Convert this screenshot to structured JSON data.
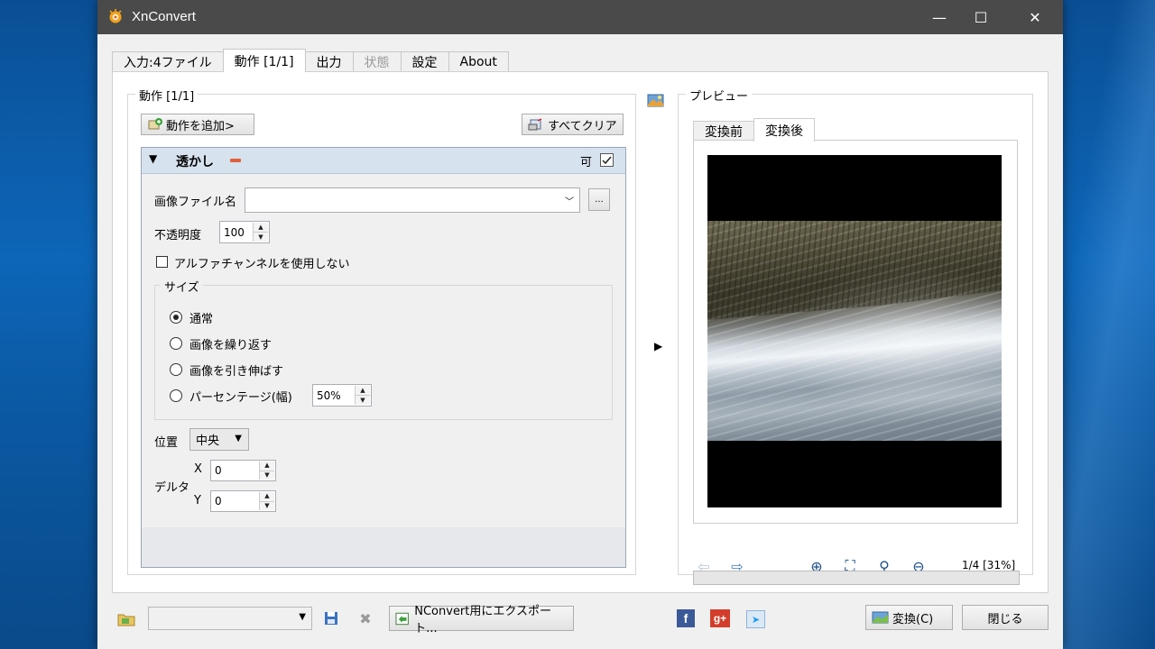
{
  "window": {
    "title": "XnConvert",
    "minimize_glyph": "—",
    "maximize_glyph": "☐",
    "close_glyph": "✕"
  },
  "main_tabs": [
    {
      "label": "入力:4ファイル",
      "state": "normal"
    },
    {
      "label": "動作 [1/1]",
      "state": "active"
    },
    {
      "label": "出力",
      "state": "normal"
    },
    {
      "label": "状態",
      "state": "disabled"
    },
    {
      "label": "設定",
      "state": "normal"
    },
    {
      "label": "About",
      "state": "normal"
    }
  ],
  "actions_panel": {
    "legend": "動作 [1/1]",
    "add_button": "動作を追加>",
    "clear_button": "すべてクリア",
    "action": {
      "name": "透かし",
      "enabled_label": "可",
      "enabled": true,
      "image_file_label": "画像ファイル名",
      "image_file_value": "",
      "browse_button": "...",
      "opacity_label": "不透明度",
      "opacity_value": "100",
      "no_alpha_label": "アルファチャンネルを使用しない",
      "no_alpha_checked": false,
      "size_legend": "サイズ",
      "size_options": [
        {
          "label": "通常",
          "checked": true
        },
        {
          "label": "画像を繰り返す",
          "checked": false
        },
        {
          "label": "画像を引き伸ばす",
          "checked": false
        },
        {
          "label": "パーセンテージ(幅)",
          "checked": false
        }
      ],
      "percent_value": "50%",
      "position_label": "位置",
      "position_value": "中央",
      "delta_label": "デルタ",
      "x_label": "X",
      "x_value": "0",
      "y_label": "Y",
      "y_value": "0"
    }
  },
  "preview_panel": {
    "legend": "プレビュー",
    "tabs": [
      {
        "label": "変換前",
        "state": "normal"
      },
      {
        "label": "変換後",
        "state": "active"
      }
    ],
    "page_info": "1/4 [31%]"
  },
  "bottom_bar": {
    "preset_value": "",
    "export_button": "NConvert用にエクスポート...",
    "convert_button": "変換(C)",
    "close_button": "閉じる"
  },
  "colors": {
    "titlebar": "#4a4a4a",
    "action_header": "#d6e2ee",
    "window_bg": "#f0f0f0"
  }
}
